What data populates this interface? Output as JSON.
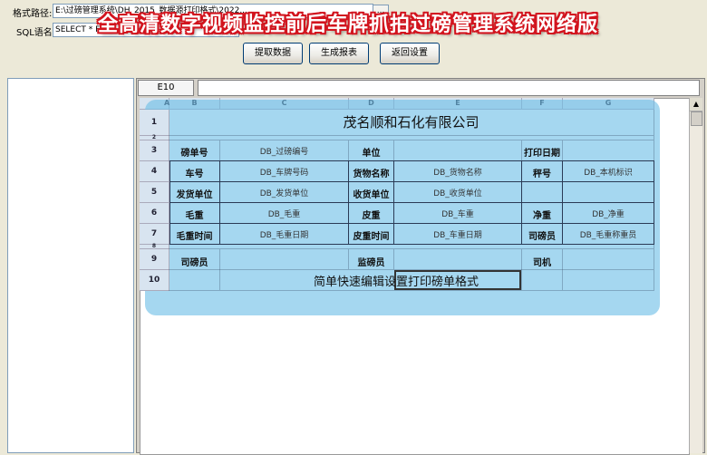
{
  "form": {
    "path_label": "格式路径:",
    "path_value": "E:\\过磅管理系统\\DH_2015_数据源打印格式\\2022...",
    "browse_label": "...",
    "sql_label": "SQL语名:",
    "sql_value": "SELECT * F"
  },
  "headline": "全高清数字视频监控前后车牌抓拍过磅管理系统网络版",
  "buttons": {
    "fetch": "提取数据",
    "report": "生成报表",
    "back": "返回设置"
  },
  "sheet": {
    "cell_ref": "E10",
    "formula": "",
    "columns": [
      "A",
      "B",
      "C",
      "D",
      "E",
      "F",
      "G"
    ],
    "rows": [
      "1",
      "2",
      "3",
      "4",
      "5",
      "6",
      "7",
      "8",
      "9",
      "10"
    ]
  },
  "report": {
    "company": "茂名顺和石化有限公司",
    "r3": {
      "l1": "磅单号",
      "f1": "DB_过磅编号",
      "l2": "单位",
      "l3": "打印日期"
    },
    "r4": {
      "l1": "车号",
      "f1": "DB_车牌号码",
      "l2": "货物名称",
      "f2": "DB_货物名称",
      "l3": "秤号",
      "f3": "DB_本机标识"
    },
    "r5": {
      "l1": "发货单位",
      "f1": "DB_发货单位",
      "l2": "收货单位",
      "f2": "DB_收货单位"
    },
    "r6": {
      "l1": "毛重",
      "f1": "DB_毛重",
      "l2": "皮重",
      "f2": "DB_车重",
      "l3": "净重",
      "f3": "DB_净重"
    },
    "r7": {
      "l1": "毛重时间",
      "f1": "DB_毛重日期",
      "l2": "皮重时间",
      "f2": "DB_车重日期",
      "l3": "司磅员",
      "f3": "DB_毛重称重员"
    },
    "r9": {
      "l1": "司磅员",
      "l2": "监磅员",
      "l3": "司机"
    },
    "note": "简单快速编辑设置打印磅单格式"
  }
}
